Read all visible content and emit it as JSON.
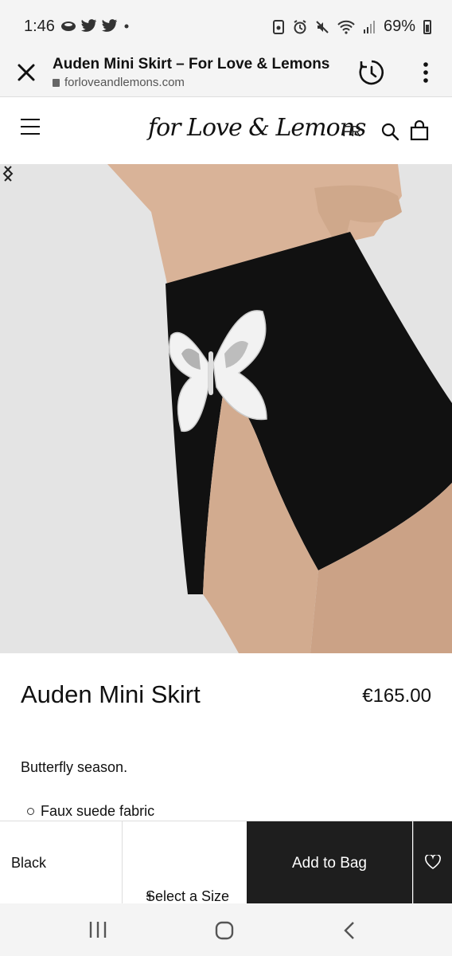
{
  "status_bar": {
    "time": "1:46",
    "battery": "69%",
    "left_icons": [
      "cloud-icon",
      "twitter-icon",
      "twitter-icon",
      "dot-icon"
    ],
    "right_icons": [
      "lock-app-icon",
      "alarm-icon",
      "mute-icon",
      "wifi-icon",
      "signal-icon",
      "battery-icon"
    ]
  },
  "browser": {
    "title": "Auden Mini Skirt – For Love & Lemons",
    "url": "forloveandlemons.com",
    "close_icon": "close-icon",
    "history_icon": "history-icon",
    "menu_icon": "more-vertical-icon"
  },
  "site_nav": {
    "logo": "for Love & Lemons",
    "language": "FR",
    "menu_icon": "hamburger-icon",
    "search_icon": "search-icon",
    "bag_icon": "bag-icon"
  },
  "product": {
    "name": "Auden Mini Skirt",
    "price": "€165.00",
    "description": "Butterfly season.",
    "features": [
      "Faux suede fabric"
    ]
  },
  "purchase_bar": {
    "color": "Black",
    "size_label": "Select a Size",
    "size_plus": "+",
    "add_to_bag": "Add to Bag",
    "wishlist_icon": "heart-icon"
  },
  "colors": {
    "accent_dark": "#1e1e1e",
    "chrome_bg": "#f4f4f4"
  }
}
